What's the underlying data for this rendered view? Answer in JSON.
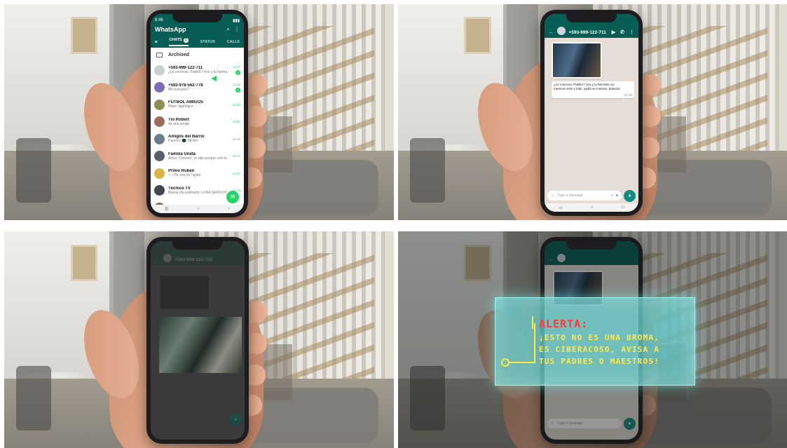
{
  "panel1": {
    "status_time": "8:46",
    "app_title": "WhatsApp",
    "tabs": [
      {
        "label": "CHATS",
        "badge": "2"
      },
      {
        "label": "STATUS"
      },
      {
        "label": "CALLS"
      }
    ],
    "archived_label": "Archived",
    "chats": [
      {
        "name": "+593-999-122-711",
        "msg": "¿Le conoces, Pablito? Vos y tu hermano...",
        "time": "13:17",
        "unread": "1",
        "avatar_color": "#c9cfd5"
      },
      {
        "name": "+593-978-562-778",
        "msg": "Me borraste?",
        "time": "13:15",
        "unread": "1",
        "avatar_color": "#7c6db7"
      },
      {
        "name": "FÚTBOL AMIGOS",
        "msg": "Pepe: ligamigos",
        "time": "13:02",
        "unread": "",
        "avatar_color": "#8b8f57"
      },
      {
        "name": "Tío Robert",
        "msg": "de una amigo",
        "time": "14:01",
        "unread": "",
        "avatar_color": "#9b6d5e"
      },
      {
        "name": "Amigos del Barrio",
        "msg": "Pancho: 🌑 Sticker",
        "time": "14:36",
        "unread": "",
        "avatar_color": "#6d7c8d"
      },
      {
        "name": "Familia Unida",
        "msg": "Alicia: Chevere, yo dije porque solo la fe...",
        "time": "14:27",
        "unread": "",
        "avatar_color": "#55606c"
      },
      {
        "name": "Primo Ruben",
        "msg": "✓✓De una tío! ayalá",
        "time": "14:27",
        "unread": "",
        "avatar_color": "#d9b64a"
      },
      {
        "name": "Técnico TV",
        "msg": "Buena día estimado. LUNA SERVICIO...",
        "time": "12:14",
        "unread": "",
        "avatar_color": "#3f4752"
      },
      {
        "name": "Gaby Fuentes",
        "msg": "",
        "time": "",
        "unread": "",
        "avatar_color": "#7a6b5f"
      }
    ]
  },
  "panel2": {
    "status_time": "8:46",
    "contact": "+593-999-122-711",
    "message_text": "¿Le conoces, Pablito? Vos y tu hermano se merecen esto y más, ayalá se mueran, basuras.",
    "message_time": "21:38",
    "input_placeholder": "Type a message"
  },
  "panel3": {
    "contact": "+593-999-122-711"
  },
  "panel4": {
    "alert_title": "ALERTA:",
    "alert_lines": [
      "¡ESTO NO ES UNA BROMA,",
      "ES CIBERACOSO, AVISA A",
      "TUS PADRES O MAESTROS!"
    ],
    "input_placeholder": "Type a message"
  },
  "colors": {
    "whatsapp_green": "#075e54",
    "accent_green": "#25d366",
    "alert_red": "#ff3838",
    "alert_yellow": "#ffe94a",
    "alert_bg": "#68d3d2"
  }
}
